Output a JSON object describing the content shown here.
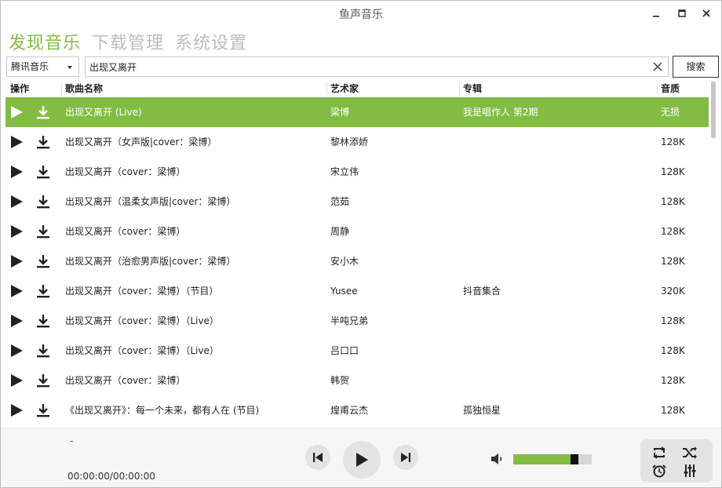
{
  "window": {
    "title": "鱼声音乐"
  },
  "nav": {
    "tabs": [
      {
        "label": "发现音乐",
        "active": true
      },
      {
        "label": "下载管理",
        "active": false
      },
      {
        "label": "系统设置",
        "active": false
      }
    ]
  },
  "search": {
    "source_selected": "腾讯音乐",
    "query": "出现又离开",
    "button_label": "搜索"
  },
  "table": {
    "columns": {
      "action": "操作",
      "song": "歌曲名称",
      "artist": "艺术家",
      "album": "专辑",
      "quality": "音质"
    },
    "rows": [
      {
        "song": "出现又离开 (Live)",
        "artist": "梁博",
        "album": "我是唱作人 第2期",
        "quality": "无损",
        "selected": true
      },
      {
        "song": "出现又离开（女声版|cover：梁博）",
        "artist": "黎林添娇",
        "album": "",
        "quality": "128K"
      },
      {
        "song": "出现又离开（cover：梁博）",
        "artist": "宋立伟",
        "album": "",
        "quality": "128K"
      },
      {
        "song": "出现又离开（温柔女声版|cover：梁博）",
        "artist": "范茹",
        "album": "",
        "quality": "128K"
      },
      {
        "song": "出现又离开（cover：梁博）",
        "artist": "周静",
        "album": "",
        "quality": "128K"
      },
      {
        "song": "出现又离开（治愈男声版|cover：梁博）",
        "artist": "安小木",
        "album": "",
        "quality": "128K"
      },
      {
        "song": "出现又离开（cover：梁博）（节目）",
        "artist": "Yusee",
        "album": "抖音集合",
        "quality": "320K"
      },
      {
        "song": "出现又离开（cover：梁博）（Live）",
        "artist": "半吨兄弟",
        "album": "",
        "quality": "128K"
      },
      {
        "song": "出现又离开（cover：梁博）（Live）",
        "artist": "吕口口",
        "album": "",
        "quality": "128K"
      },
      {
        "song": "出现又离开（cover：梁博）",
        "artist": "韩贺",
        "album": "",
        "quality": "128K"
      },
      {
        "song": "《出现又离开》：每一个未来，都有人在 (节目)",
        "artist": "煌甫云杰",
        "album": "孤独恒星",
        "quality": "128K"
      }
    ]
  },
  "player": {
    "song": "-",
    "time": "00:00:00/00:00:00",
    "volume": 0.81
  },
  "colors": {
    "accent": "#82bc45",
    "tab_inactive": "#bcbcbc"
  },
  "icons": {
    "window": [
      "minimize-icon",
      "maximize-icon",
      "close-icon"
    ],
    "row": [
      "play-icon",
      "download-icon"
    ],
    "player": [
      "previous-icon",
      "play-icon",
      "next-icon",
      "volume-icon"
    ],
    "controls": [
      "repeat-icon",
      "shuffle-icon",
      "alarm-icon",
      "equalizer-icon"
    ]
  }
}
